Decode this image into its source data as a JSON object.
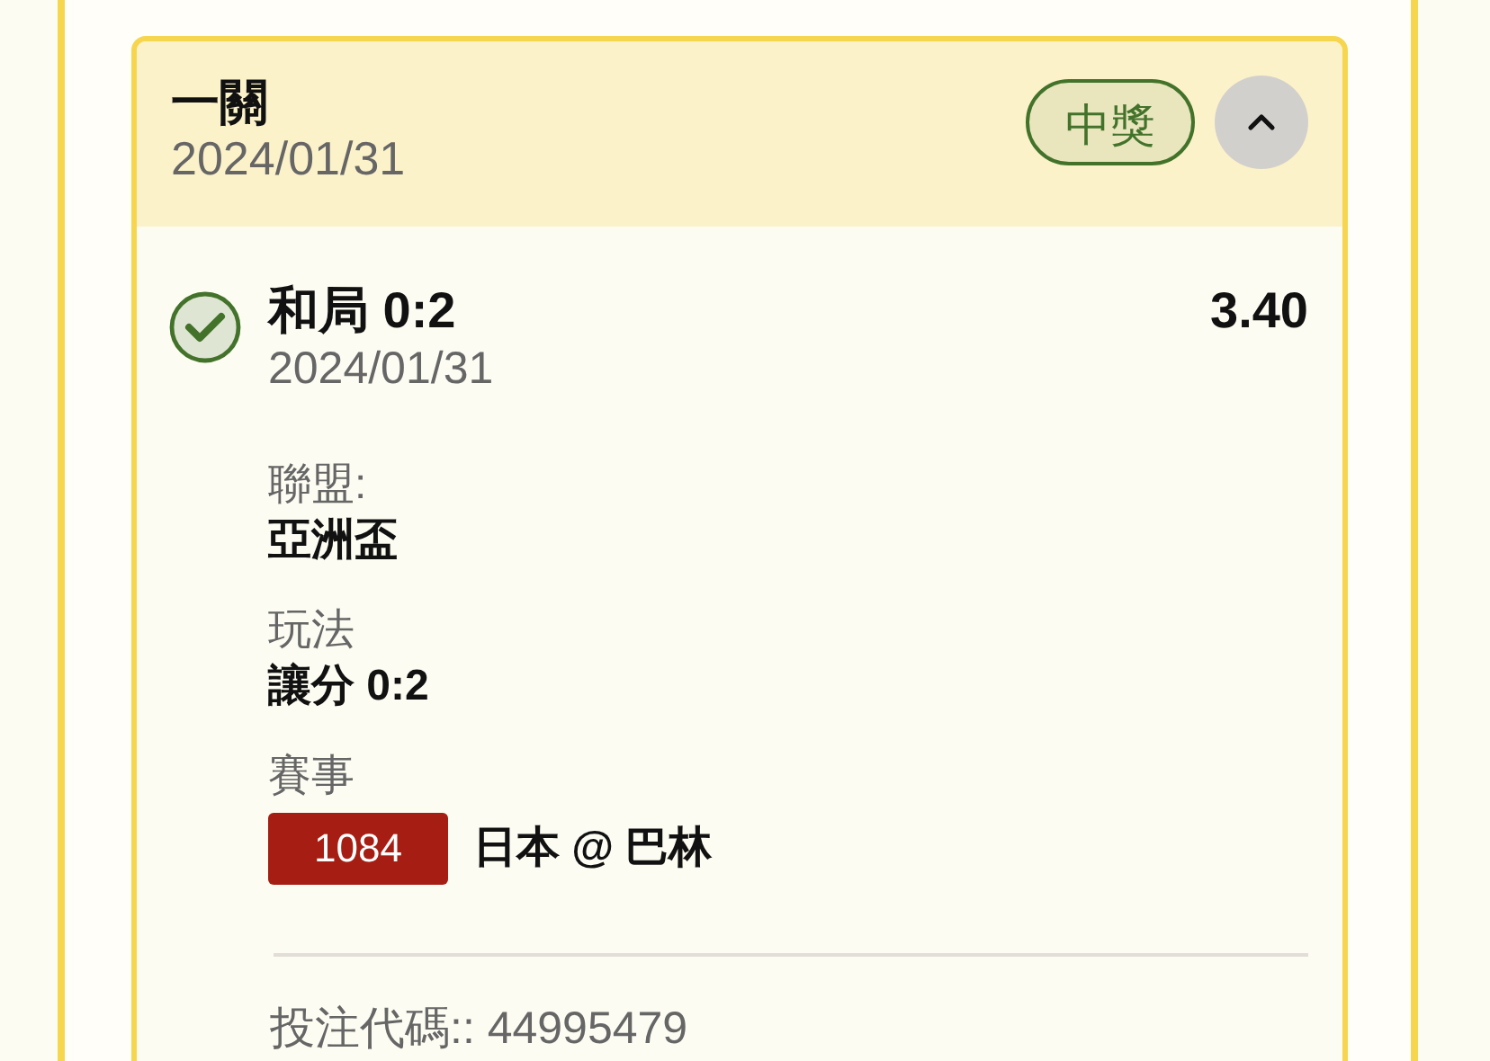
{
  "bet_card": {
    "title": "一關",
    "date": "2024/01/31",
    "status": {
      "label": "中獎",
      "kind": "won"
    },
    "expanded": true,
    "selection": {
      "won": true,
      "name": "和局 0:2",
      "date": "2024/01/31",
      "odds": "3.40",
      "fields": [
        {
          "label": "聯盟:",
          "value": "亞洲盃"
        },
        {
          "label": "玩法",
          "value": "讓分 0:2"
        }
      ],
      "event": {
        "label": "賽事",
        "code": "1084",
        "teams": "日本 @ 巴林"
      }
    },
    "bet_code": "投注代碼:: 44995479"
  }
}
